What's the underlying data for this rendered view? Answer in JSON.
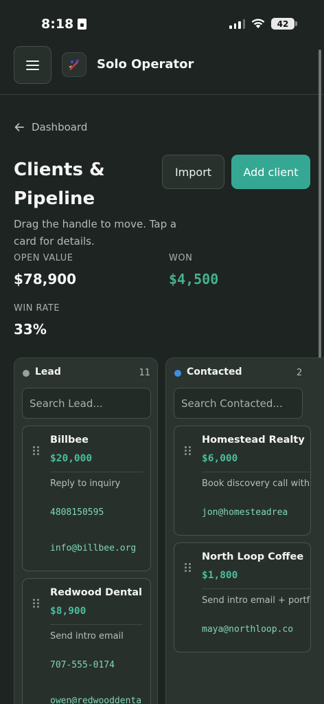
{
  "status_bar": {
    "time": "8:18",
    "battery": "42"
  },
  "header": {
    "app_title": "Solo Operator"
  },
  "breadcrumb": {
    "label": "Dashboard"
  },
  "page": {
    "title": "Clients & Pipeline",
    "subtitle": "Drag the handle to move. Tap a card for details.",
    "import_label": "Import",
    "add_label": "Add client"
  },
  "stats": {
    "open_value_label": "OPEN VALUE",
    "open_value": "$78,900",
    "won_label": "WON",
    "won": "$4,500",
    "win_rate_label": "WIN RATE",
    "win_rate": "33%"
  },
  "columns": [
    {
      "name": "Lead",
      "count": "11",
      "dot_color": "#9aa19c",
      "search_placeholder": "Search Lead...",
      "cards": [
        {
          "title": "Billbee",
          "value": "$20,000",
          "task": "Reply to inquiry",
          "phone": "4808150595",
          "email": "info@billbee.org"
        },
        {
          "title": "Redwood Dental",
          "value": "$8,900",
          "task": "Send intro email",
          "phone": "707-555-0174",
          "email": "owen@redwooddenta"
        }
      ]
    },
    {
      "name": "Contacted",
      "count": "2",
      "dot_color": "#3d8fe0",
      "search_placeholder": "Search Contacted...",
      "cards": [
        {
          "title": "Homestead Realty",
          "value": "$6,000",
          "task": "Book discovery call with",
          "email": "jon@homesteadrea"
        },
        {
          "title": "North Loop Coffee",
          "value": "$1,800",
          "task": "Send intro email + portf",
          "email": "maya@northloop.co"
        }
      ]
    }
  ],
  "colors": {
    "accent": "#35a894",
    "won": "#45b18f",
    "background": "#1e2421"
  }
}
